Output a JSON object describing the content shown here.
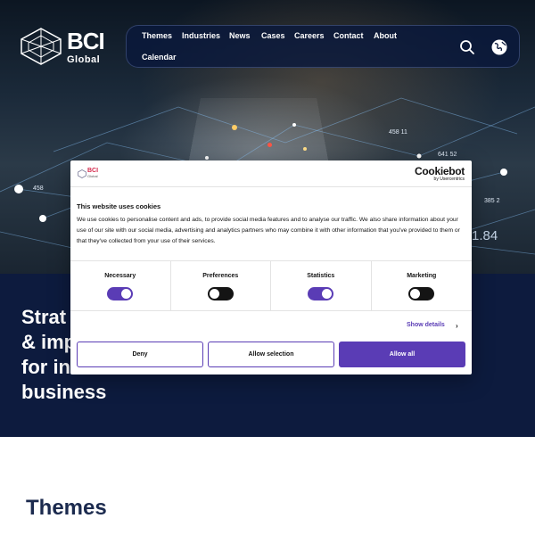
{
  "brand": {
    "name": "BCI",
    "subname": "Global"
  },
  "nav": {
    "items": [
      "Themes",
      "Industries",
      "News",
      "Cases",
      "Careers",
      "Contact",
      "About",
      "Calendar"
    ],
    "search_icon": "search-icon",
    "language_icon": "globe-icon"
  },
  "hero": {
    "overlay_labels": [
      "641 52",
      "458",
      "458 11",
      "385 2",
      "1.84"
    ]
  },
  "headline": {
    "lines": [
      "Strat",
      "& imp",
      "for in",
      "business"
    ],
    "side_fragment": "n"
  },
  "themes": {
    "title": "Themes"
  },
  "cookie": {
    "mini_logo_text": "BCI",
    "mini_logo_sub": "Global",
    "brand_main": "Cookiebot",
    "brand_sub": "by Usercentrics",
    "title": "This website uses cookies",
    "body": "We use cookies to personalise content and ads, to provide social media features and to analyse our traffic. We also share information about your use of our site with our social media, advertising and analytics partners who may combine it with other information that you've provided to them or that they've collected from your use of their services.",
    "toggles": [
      {
        "label": "Necessary",
        "on": true
      },
      {
        "label": "Preferences",
        "on": false
      },
      {
        "label": "Statistics",
        "on": true
      },
      {
        "label": "Marketing",
        "on": false
      }
    ],
    "show_details": "Show details",
    "buttons": {
      "deny": "Deny",
      "allow_selection": "Allow selection",
      "allow_all": "Allow all"
    },
    "accent": "#5a3cb5"
  },
  "colors": {
    "navy": "#0d1b3e",
    "themes_title": "#1b2a4e"
  }
}
